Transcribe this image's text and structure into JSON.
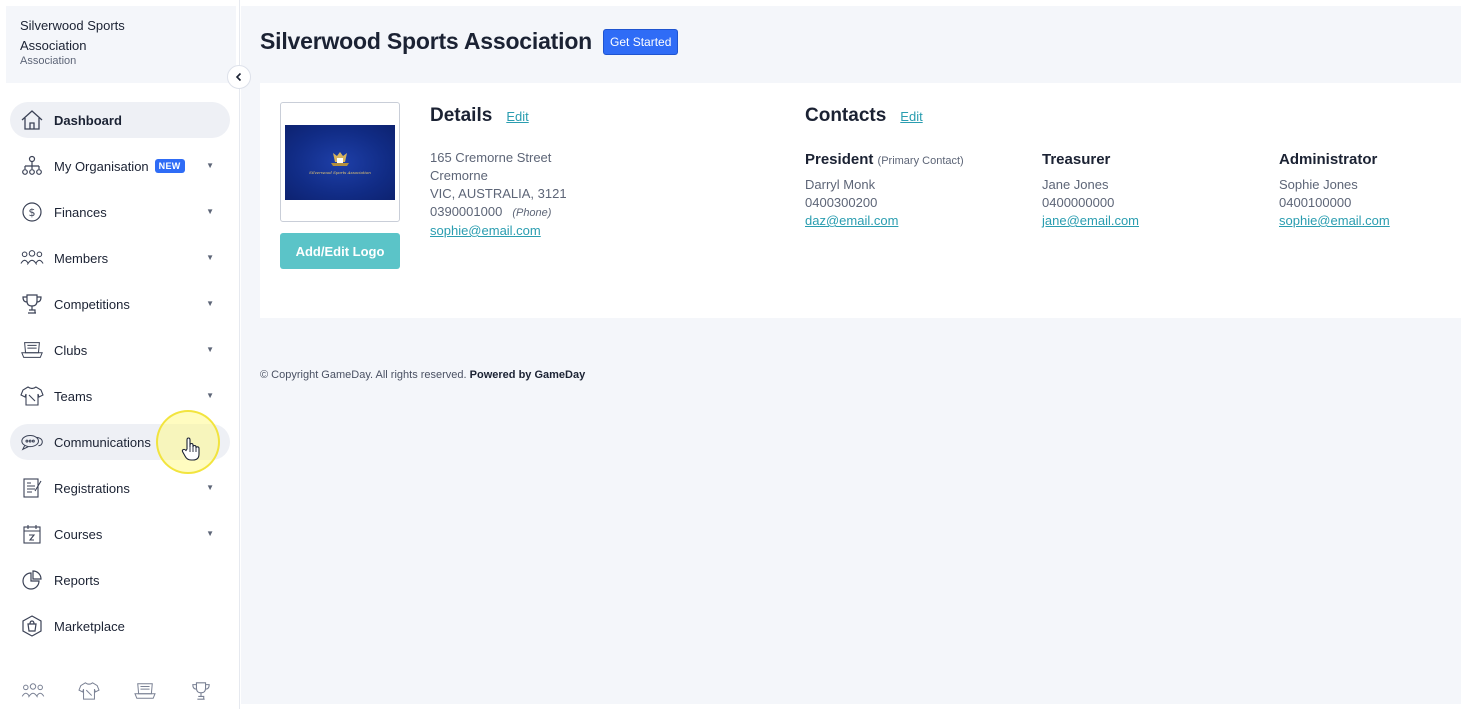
{
  "org": {
    "name": "Silverwood Sports Association",
    "type": "Association"
  },
  "nav": {
    "items": [
      {
        "label": "Dashboard",
        "icon": "home-icon"
      },
      {
        "label": "My Organisation",
        "badge": "NEW",
        "icon": "org-chart-icon"
      },
      {
        "label": "Finances",
        "icon": "dollar-icon"
      },
      {
        "label": "Members",
        "icon": "members-icon"
      },
      {
        "label": "Competitions",
        "icon": "trophy-icon"
      },
      {
        "label": "Clubs",
        "icon": "club-icon"
      },
      {
        "label": "Teams",
        "icon": "jersey-icon"
      },
      {
        "label": "Communications",
        "icon": "chat-icon"
      },
      {
        "label": "Registrations",
        "icon": "registration-icon"
      },
      {
        "label": "Courses",
        "icon": "calendar-icon"
      },
      {
        "label": "Reports",
        "icon": "pie-chart-icon"
      },
      {
        "label": "Marketplace",
        "icon": "shopping-bag-icon"
      }
    ]
  },
  "header": {
    "title": "Silverwood Sports Association",
    "get_started": "Get Started"
  },
  "details": {
    "title": "Details",
    "edit": "Edit",
    "street": "165 Cremorne Street",
    "suburb": "Cremorne",
    "region": "VIC,  AUSTRALIA,  3121",
    "phone": "0390001000",
    "phone_note": "(Phone)",
    "email": "sophie@email.com",
    "logo_button": "Add/Edit Logo",
    "logo_text": "Silverwood Sports Association"
  },
  "contacts": {
    "title": "Contacts",
    "edit": "Edit",
    "list": [
      {
        "role": "President",
        "note": "(Primary Contact)",
        "name": "Darryl Monk",
        "phone": "0400300200",
        "email": "daz@email.com"
      },
      {
        "role": "Treasurer",
        "note": "",
        "name": "Jane Jones",
        "phone": "0400000000",
        "email": "jane@email.com"
      },
      {
        "role": "Administrator",
        "note": "",
        "name": "Sophie Jones",
        "phone": "0400100000",
        "email": "sophie@email.com"
      }
    ]
  },
  "footer": {
    "copyright": "Copyright GameDay. All rights reserved.",
    "powered": "Powered by GameDay"
  },
  "colors": {
    "accent_blue": "#2f6cf6",
    "teal": "#5bc4c8",
    "link": "#2a9db0",
    "bg": "#f4f6fa"
  }
}
